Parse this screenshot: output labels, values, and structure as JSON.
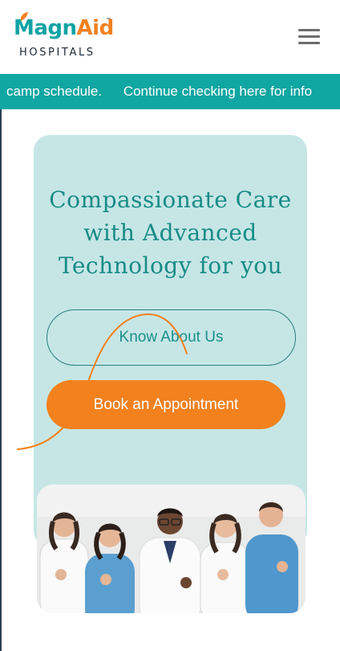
{
  "brand": {
    "name_part1": "Magn",
    "name_part2": "Aid",
    "trademark": "™",
    "subtitle": "HOSPITALS",
    "primary_color": "#0fa3a3",
    "accent_color": "#f28121"
  },
  "menu": {
    "icon": "hamburger-menu-icon"
  },
  "ticker": {
    "items": [
      "camp schedule.",
      "Continue checking here for info"
    ],
    "background": "#10a6a1"
  },
  "hero": {
    "title_lines": [
      "Compassionate Care",
      "with Advanced",
      "Technology for you"
    ],
    "know_button": "Know About Us",
    "book_button": "Book an Appointment",
    "card_color": "#c6e6e6"
  },
  "photo": {
    "alt": "Group of smiling doctors giving thumbs up"
  }
}
